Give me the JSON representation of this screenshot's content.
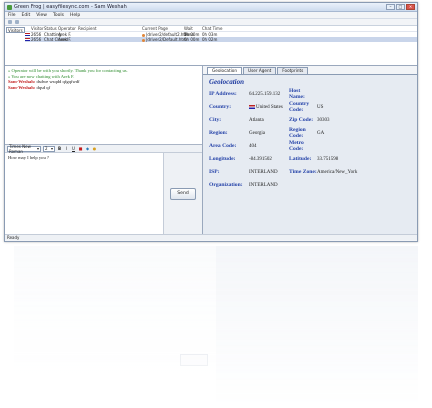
{
  "window": {
    "title": "Green Frog | easyfilesync.com - Sam Weshah"
  },
  "menu": [
    "File",
    "Edit",
    "View",
    "Tools",
    "Help"
  ],
  "visitors": {
    "tab_label": "Visitors",
    "columns": [
      "Visitor",
      "Status",
      "Operator",
      "Recipient",
      "Current Page",
      "Wait Time",
      "Chat Time"
    ],
    "rows": [
      {
        "visitor": "2656",
        "status": "Chatting",
        "operator": "Arek F.",
        "recipient": "",
        "page": "|driver2/default2.htm",
        "wait": "0h 00m",
        "chat": "0h 03m"
      },
      {
        "visitor": "2656",
        "status": "Chat Closed",
        "operator": "Arek F.",
        "recipient": "",
        "page": "|driver2/Default.htm",
        "wait": "0h 00m",
        "chat": "0h 02m"
      }
    ]
  },
  "chat": {
    "lines": [
      {
        "style": "green",
        "prefix": "",
        "text": "Operator will be with you shortly. Thank you for contacting us."
      },
      {
        "style": "green",
        "prefix": "",
        "text": "You are now chatting with Arek F."
      },
      {
        "style": "red",
        "prefix": "Sam-Weshah:",
        "text": " dsdwe wsqdd qfgqfwdf"
      },
      {
        "style": "red",
        "prefix": "Sam-Weshah:",
        "text": " dqsd qf"
      }
    ],
    "font_name": "Times New Roman",
    "font_size": "2",
    "format_buttons": [
      "B",
      "I",
      "U"
    ],
    "input_text": "How may I help you ?",
    "send_label": "Send"
  },
  "right_tabs": [
    "Geolocation",
    "User Agent",
    "Footprints"
  ],
  "geo": {
    "title": "Geolocation",
    "fields": [
      {
        "l1": "IP Address:",
        "v1": "64.225.159.132",
        "l2": "Host Name:",
        "v2": ""
      },
      {
        "l1": "Country:",
        "v1": "United States",
        "l2": "Country Code:",
        "v2": "US"
      },
      {
        "l1": "City:",
        "v1": "Atlanta",
        "l2": "Zip Code:",
        "v2": "30303"
      },
      {
        "l1": "Region:",
        "v1": "Georgia",
        "l2": "Region Code:",
        "v2": "GA"
      },
      {
        "l1": "Area Code:",
        "v1": "404",
        "l2": "Metro Code:",
        "v2": ""
      },
      {
        "l1": "Longitude:",
        "v1": "-84.391502",
        "l2": "Latitude:",
        "v2": "33.751598"
      },
      {
        "l1": "ISP:",
        "v1": "INTERLAND",
        "l2": "Time Zone:",
        "v2": "America/New_York"
      },
      {
        "l1": "Organization:",
        "v1": "INTERLAND",
        "l2": "",
        "v2": ""
      }
    ]
  },
  "status_text": "Ready",
  "colors": {
    "accent": "#2442a8",
    "chat_green": "#2a8a2a",
    "chat_red": "#c21e1e",
    "close": "#d8544c"
  }
}
